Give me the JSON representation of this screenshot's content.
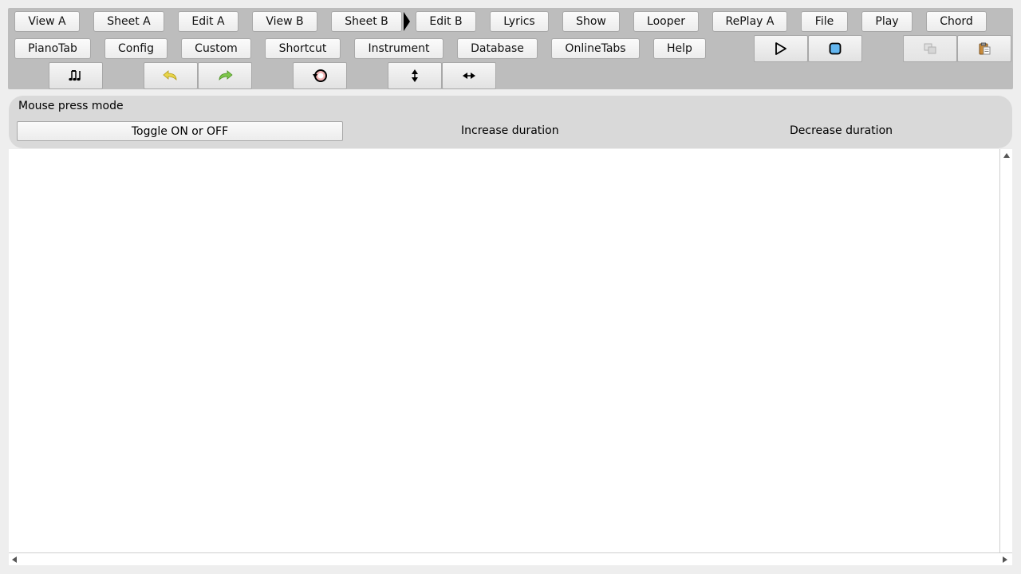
{
  "menu_row1": [
    "View A",
    "Sheet A",
    "Edit A",
    "View B",
    "Sheet B",
    "Edit B",
    "Lyrics",
    "Show",
    "Looper",
    "RePlay A",
    "File",
    "Play",
    "Chord"
  ],
  "menu_row2": [
    "PianoTab",
    "Config",
    "Custom",
    "Shortcut",
    "Instrument",
    "Database",
    "OnlineTabs",
    "Help"
  ],
  "transport": {
    "play_icon": "play-icon",
    "stop_icon": "stop-icon"
  },
  "clipboard": {
    "copy_icon": "copy-icon",
    "paste_icon": "paste-icon",
    "copy_enabled": false
  },
  "tools": [
    "notes-icon",
    "undo-icon",
    "redo-icon",
    "rotate-icon",
    "vertical-resize-icon",
    "horizontal-resize-icon"
  ],
  "mouse_mode": {
    "title": "Mouse press mode",
    "toggle": "Toggle ON or OFF",
    "increase": "Increase duration",
    "decrease": "Decrease duration"
  },
  "colors": {
    "toolbar_bg": "#bdbdbd",
    "panel_bg": "#d9d9d9",
    "stop_fill": "#63b6f0",
    "undo": "#e8d54a",
    "redo": "#7dc64b"
  }
}
